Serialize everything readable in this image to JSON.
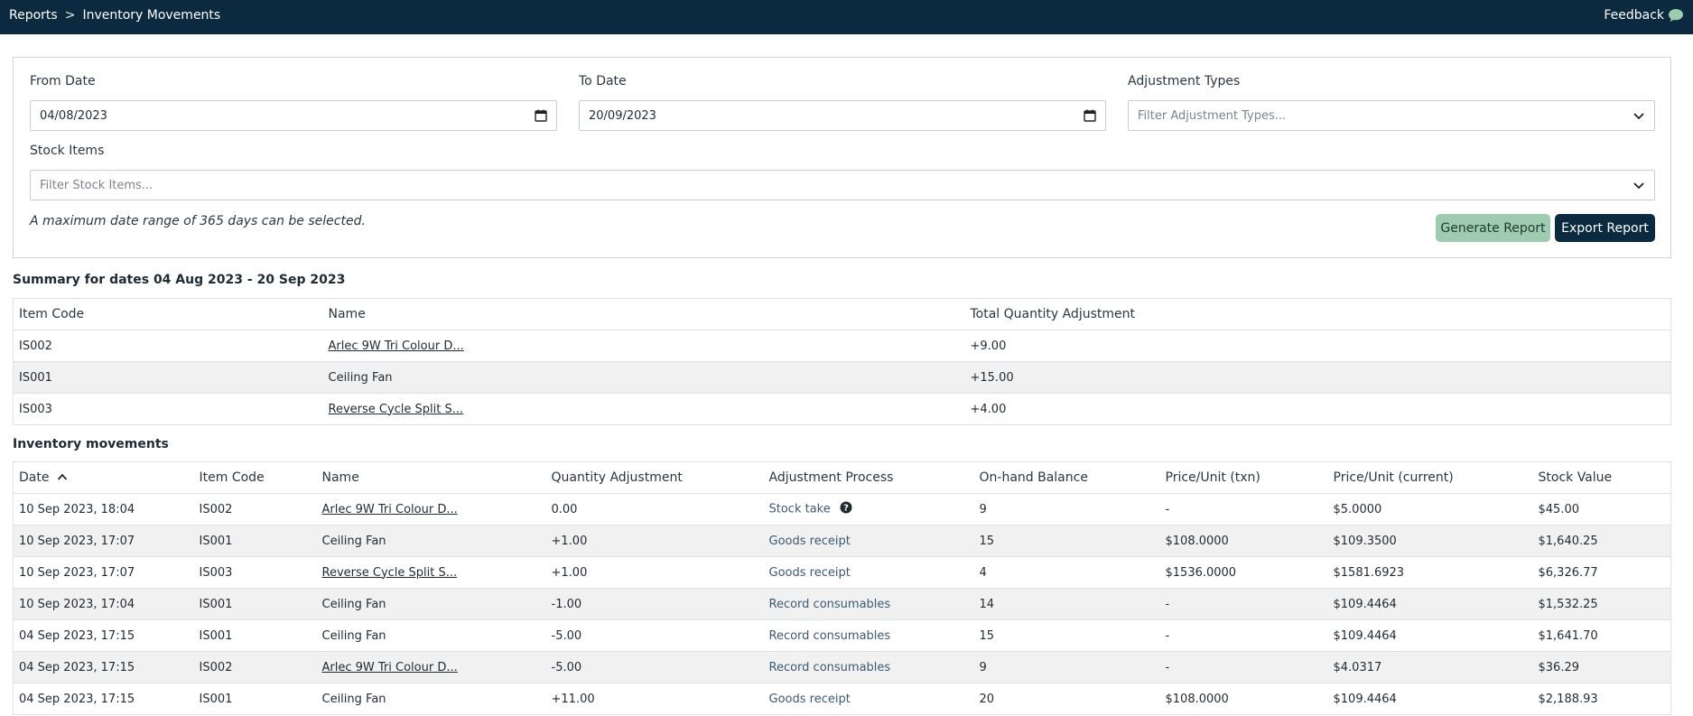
{
  "breadcrumb": {
    "root": "Reports",
    "separator": ">",
    "current": "Inventory Movements"
  },
  "header": {
    "feedback_label": "Feedback",
    "feedback_icon": "speech-bubble-icon"
  },
  "filters": {
    "from_date_label": "From Date",
    "from_date_value": "04/08/2023",
    "to_date_label": "To Date",
    "to_date_value": "20/09/2023",
    "adjustment_types_label": "Adjustment Types",
    "adjustment_types_placeholder": "Filter Adjustment Types...",
    "stock_items_label": "Stock Items",
    "stock_items_placeholder": "Filter Stock Items...",
    "hint": "A maximum date range of 365 days can be selected.",
    "generate_label": "Generate Report",
    "export_label": "Export Report"
  },
  "colors": {
    "header_bg": "#0b2a40",
    "generate_bg": "#9fcbb0",
    "export_bg": "#0b2a40",
    "link_process": "#3b5a73",
    "row_alt": "#f1f1f1"
  },
  "summary": {
    "title": "Summary for dates",
    "date_range": "04 Aug 2023 - 20 Sep 2023",
    "columns": [
      "Item Code",
      "Name",
      "Total Quantity Adjustment"
    ],
    "rows": [
      {
        "code": "IS002",
        "name": "Arlec 9W Tri Colour D...",
        "qty": "+9.00"
      },
      {
        "code": "IS001",
        "name": "Ceiling Fan",
        "qty": "+15.00"
      },
      {
        "code": "IS003",
        "name": "Reverse Cycle Split S...",
        "qty": "+4.00"
      }
    ]
  },
  "movements": {
    "title": "Inventory movements",
    "sort_icon": "chevron-up-icon",
    "columns": [
      "Date",
      "Item Code",
      "Name",
      "Quantity Adjustment",
      "Adjustment Process",
      "On-hand Balance",
      "Price/Unit (txn)",
      "Price/Unit (current)",
      "Stock Value"
    ],
    "rows": [
      {
        "date": "10 Sep 2023, 18:04",
        "code": "IS002",
        "name": "Arlec 9W Tri Colour D...",
        "qty": "0.00",
        "process": "Stock take",
        "balance": "9",
        "price_txn": "-",
        "price_cur": "$5.0000",
        "value": "$45.00"
      },
      {
        "date": "10 Sep 2023, 17:07",
        "code": "IS001",
        "name": "Ceiling Fan",
        "qty": "+1.00",
        "process": "Goods receipt",
        "balance": "15",
        "price_txn": "$108.0000",
        "price_cur": "$109.3500",
        "value": "$1,640.25"
      },
      {
        "date": "10 Sep 2023, 17:07",
        "code": "IS003",
        "name": "Reverse Cycle Split S...",
        "qty": "+1.00",
        "process": "Goods receipt",
        "balance": "4",
        "price_txn": "$1536.0000",
        "price_cur": "$1581.6923",
        "value": "$6,326.77"
      },
      {
        "date": "10 Sep 2023, 17:04",
        "code": "IS001",
        "name": "Ceiling Fan",
        "qty": "-1.00",
        "process": "Record consumables",
        "balance": "14",
        "price_txn": "-",
        "price_cur": "$109.4464",
        "value": "$1,532.25"
      },
      {
        "date": "04 Sep 2023, 17:15",
        "code": "IS001",
        "name": "Ceiling Fan",
        "qty": "-5.00",
        "process": "Record consumables",
        "balance": "15",
        "price_txn": "-",
        "price_cur": "$109.4464",
        "value": "$1,641.70"
      },
      {
        "date": "04 Sep 2023, 17:15",
        "code": "IS002",
        "name": "Arlec 9W Tri Colour D...",
        "qty": "-5.00",
        "process": "Record consumables",
        "balance": "9",
        "price_txn": "-",
        "price_cur": "$4.0317",
        "value": "$36.29"
      },
      {
        "date": "04 Sep 2023, 17:15",
        "code": "IS001",
        "name": "Ceiling Fan",
        "qty": "+11.00",
        "process": "Goods receipt",
        "balance": "20",
        "price_txn": "$108.0000",
        "price_cur": "$109.4464",
        "value": "$2,188.93"
      }
    ]
  }
}
